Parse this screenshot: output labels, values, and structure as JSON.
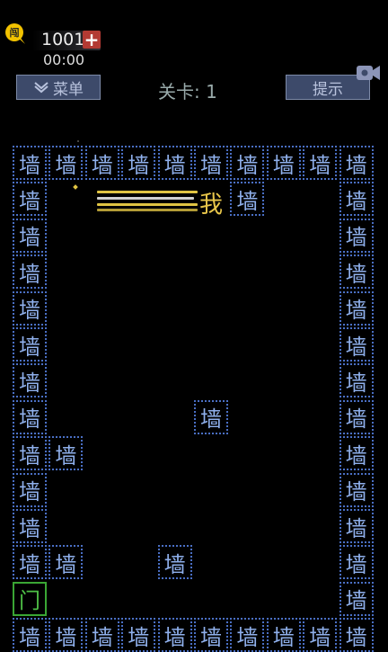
{
  "hud": {
    "coins": "1001",
    "plus_label": "+",
    "timer": "00:00",
    "menu_label": "菜单",
    "level_label": "关卡: 1",
    "hint_label": "提示"
  },
  "colors": {
    "wall_border": "#4a6fc4",
    "wall_text": "#8fb0ec",
    "door": "#3aa634",
    "player": "#e8c64a",
    "button_bg": "#3d4a6a"
  },
  "board": {
    "wall_char": "墙",
    "door_char": "门",
    "player_char": "我",
    "columns": 10,
    "rows": 14,
    "walls": [
      [
        0,
        0
      ],
      [
        0,
        1
      ],
      [
        0,
        2
      ],
      [
        0,
        3
      ],
      [
        0,
        4
      ],
      [
        0,
        5
      ],
      [
        0,
        6
      ],
      [
        0,
        7
      ],
      [
        0,
        8
      ],
      [
        0,
        9
      ],
      [
        1,
        0
      ],
      [
        1,
        6
      ],
      [
        1,
        9
      ],
      [
        2,
        0
      ],
      [
        2,
        9
      ],
      [
        3,
        0
      ],
      [
        3,
        9
      ],
      [
        4,
        0
      ],
      [
        4,
        9
      ],
      [
        5,
        0
      ],
      [
        5,
        9
      ],
      [
        6,
        0
      ],
      [
        6,
        9
      ],
      [
        7,
        0
      ],
      [
        7,
        5
      ],
      [
        7,
        9
      ],
      [
        8,
        0
      ],
      [
        8,
        1
      ],
      [
        8,
        9
      ],
      [
        9,
        0
      ],
      [
        9,
        9
      ],
      [
        10,
        0
      ],
      [
        10,
        9
      ],
      [
        11,
        0
      ],
      [
        11,
        1
      ],
      [
        11,
        4
      ],
      [
        11,
        9
      ],
      [
        12,
        9
      ],
      [
        13,
        0
      ],
      [
        13,
        1
      ],
      [
        13,
        2
      ],
      [
        13,
        3
      ],
      [
        13,
        4
      ],
      [
        13,
        5
      ],
      [
        13,
        6
      ],
      [
        13,
        7
      ],
      [
        13,
        8
      ],
      [
        13,
        9
      ]
    ],
    "door": [
      12,
      0
    ],
    "player": [
      1,
      5
    ]
  }
}
